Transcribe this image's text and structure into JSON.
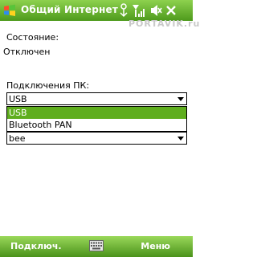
{
  "title_bar": {
    "app_title": "Общий Интернет",
    "watermark": "PORTAVIK.ru"
  },
  "status": {
    "label": "Состояние:",
    "value": "Отключен"
  },
  "pc_connection": {
    "label": "Подключения ПК:",
    "selected": "USB",
    "options": [
      "USB",
      "Bluetooth PAN"
    ]
  },
  "network": {
    "selected": "bee"
  },
  "menu_bar": {
    "left": "Подключ.",
    "right": "Меню"
  },
  "colors": {
    "accent": "#5fae1e",
    "bar_top": "#8dd14e",
    "bar_bottom": "#4e9a1c"
  }
}
